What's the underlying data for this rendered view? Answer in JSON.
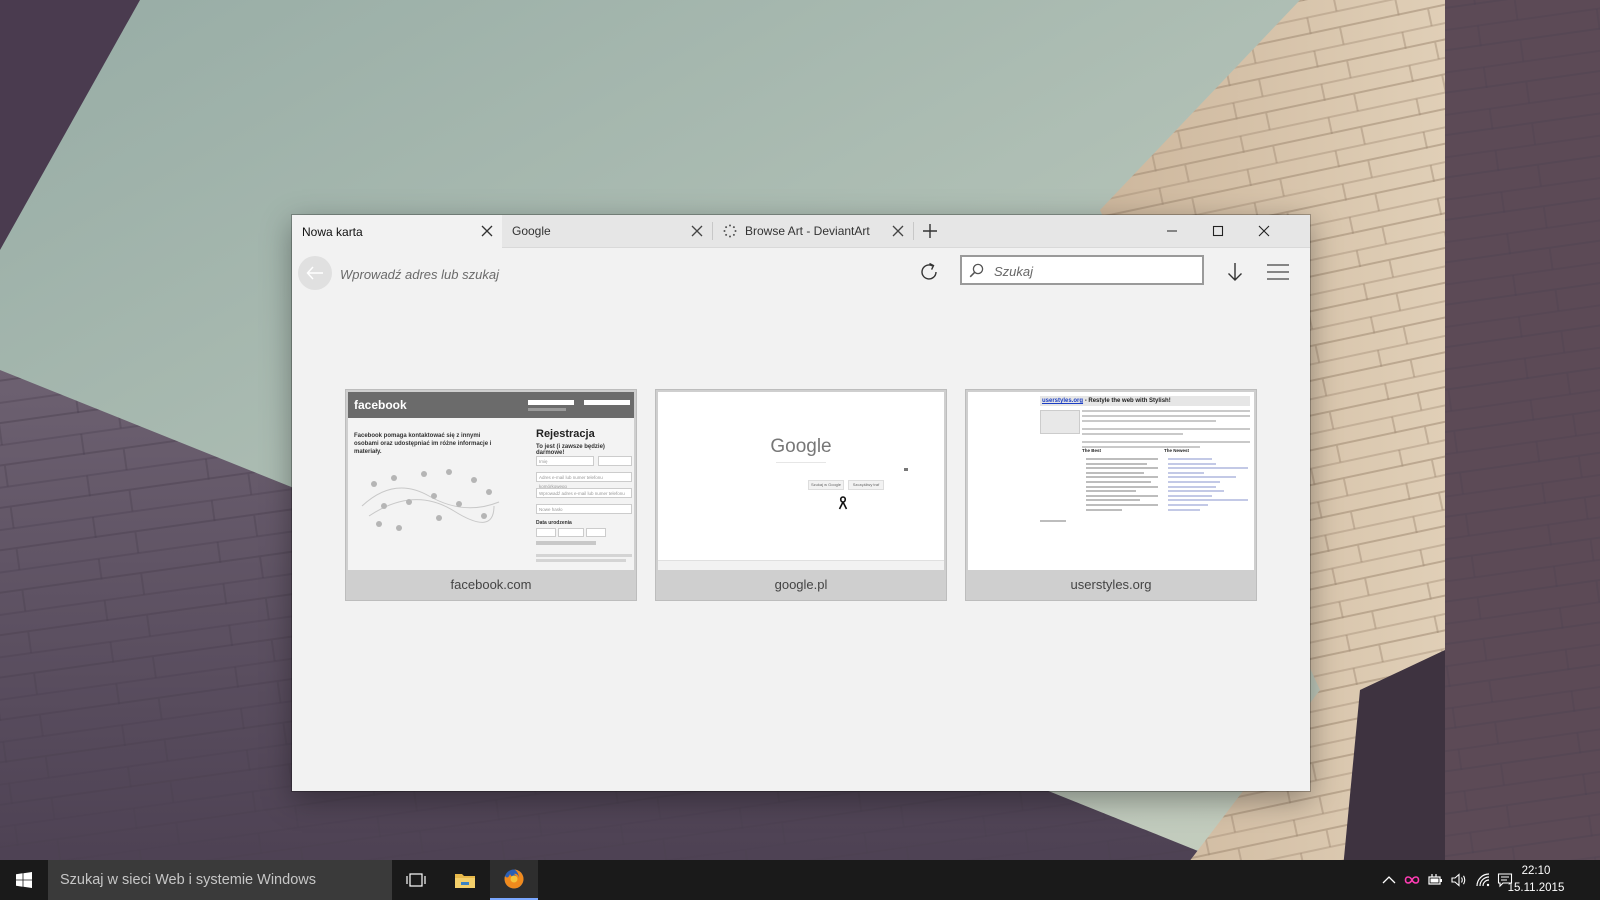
{
  "browser": {
    "tabs": [
      {
        "title": "Nowa karta",
        "active": true
      },
      {
        "title": "Google",
        "active": false
      },
      {
        "title": "Browse Art - DeviantArt",
        "active": false,
        "loading": true
      }
    ],
    "address_placeholder": "Wprowadź adres lub szukaj",
    "search_placeholder": "Szukaj"
  },
  "top_sites": [
    {
      "label": "facebook.com",
      "thumb": {
        "logo": "facebook",
        "intro": "Facebook pomaga kontaktować się z innymi osobami oraz udostępniać im różne informacje i materiały.",
        "heading": "Rejestracja",
        "subheading": "To jest (i zawsze będzie) darmowe!",
        "fields": [
          "Imię",
          "Adres e-mail lub numer telefonu komórkowego",
          "Wprowadź adres e-mail lub numer telefonu",
          "Nowe hasło"
        ],
        "birthday_label": "Data urodzenia"
      }
    },
    {
      "label": "google.pl",
      "thumb": {
        "logo": "Google",
        "buttons": [
          "Szukaj w Google",
          "Szczęśliwy traf"
        ]
      }
    },
    {
      "label": "userstyles.org",
      "thumb": {
        "site": "userstyles.org",
        "tagline": " - Restyle the web with Stylish!",
        "best_title": "The Best",
        "newest_title": "The Newest"
      }
    }
  ],
  "taskbar": {
    "search_placeholder": "Szukaj w sieci Web i systemie Windows",
    "time": "22:10",
    "date": "15.11.2015"
  },
  "colors": {
    "accent": "#7aa7ff",
    "tray_pink": "#ff3db4"
  }
}
